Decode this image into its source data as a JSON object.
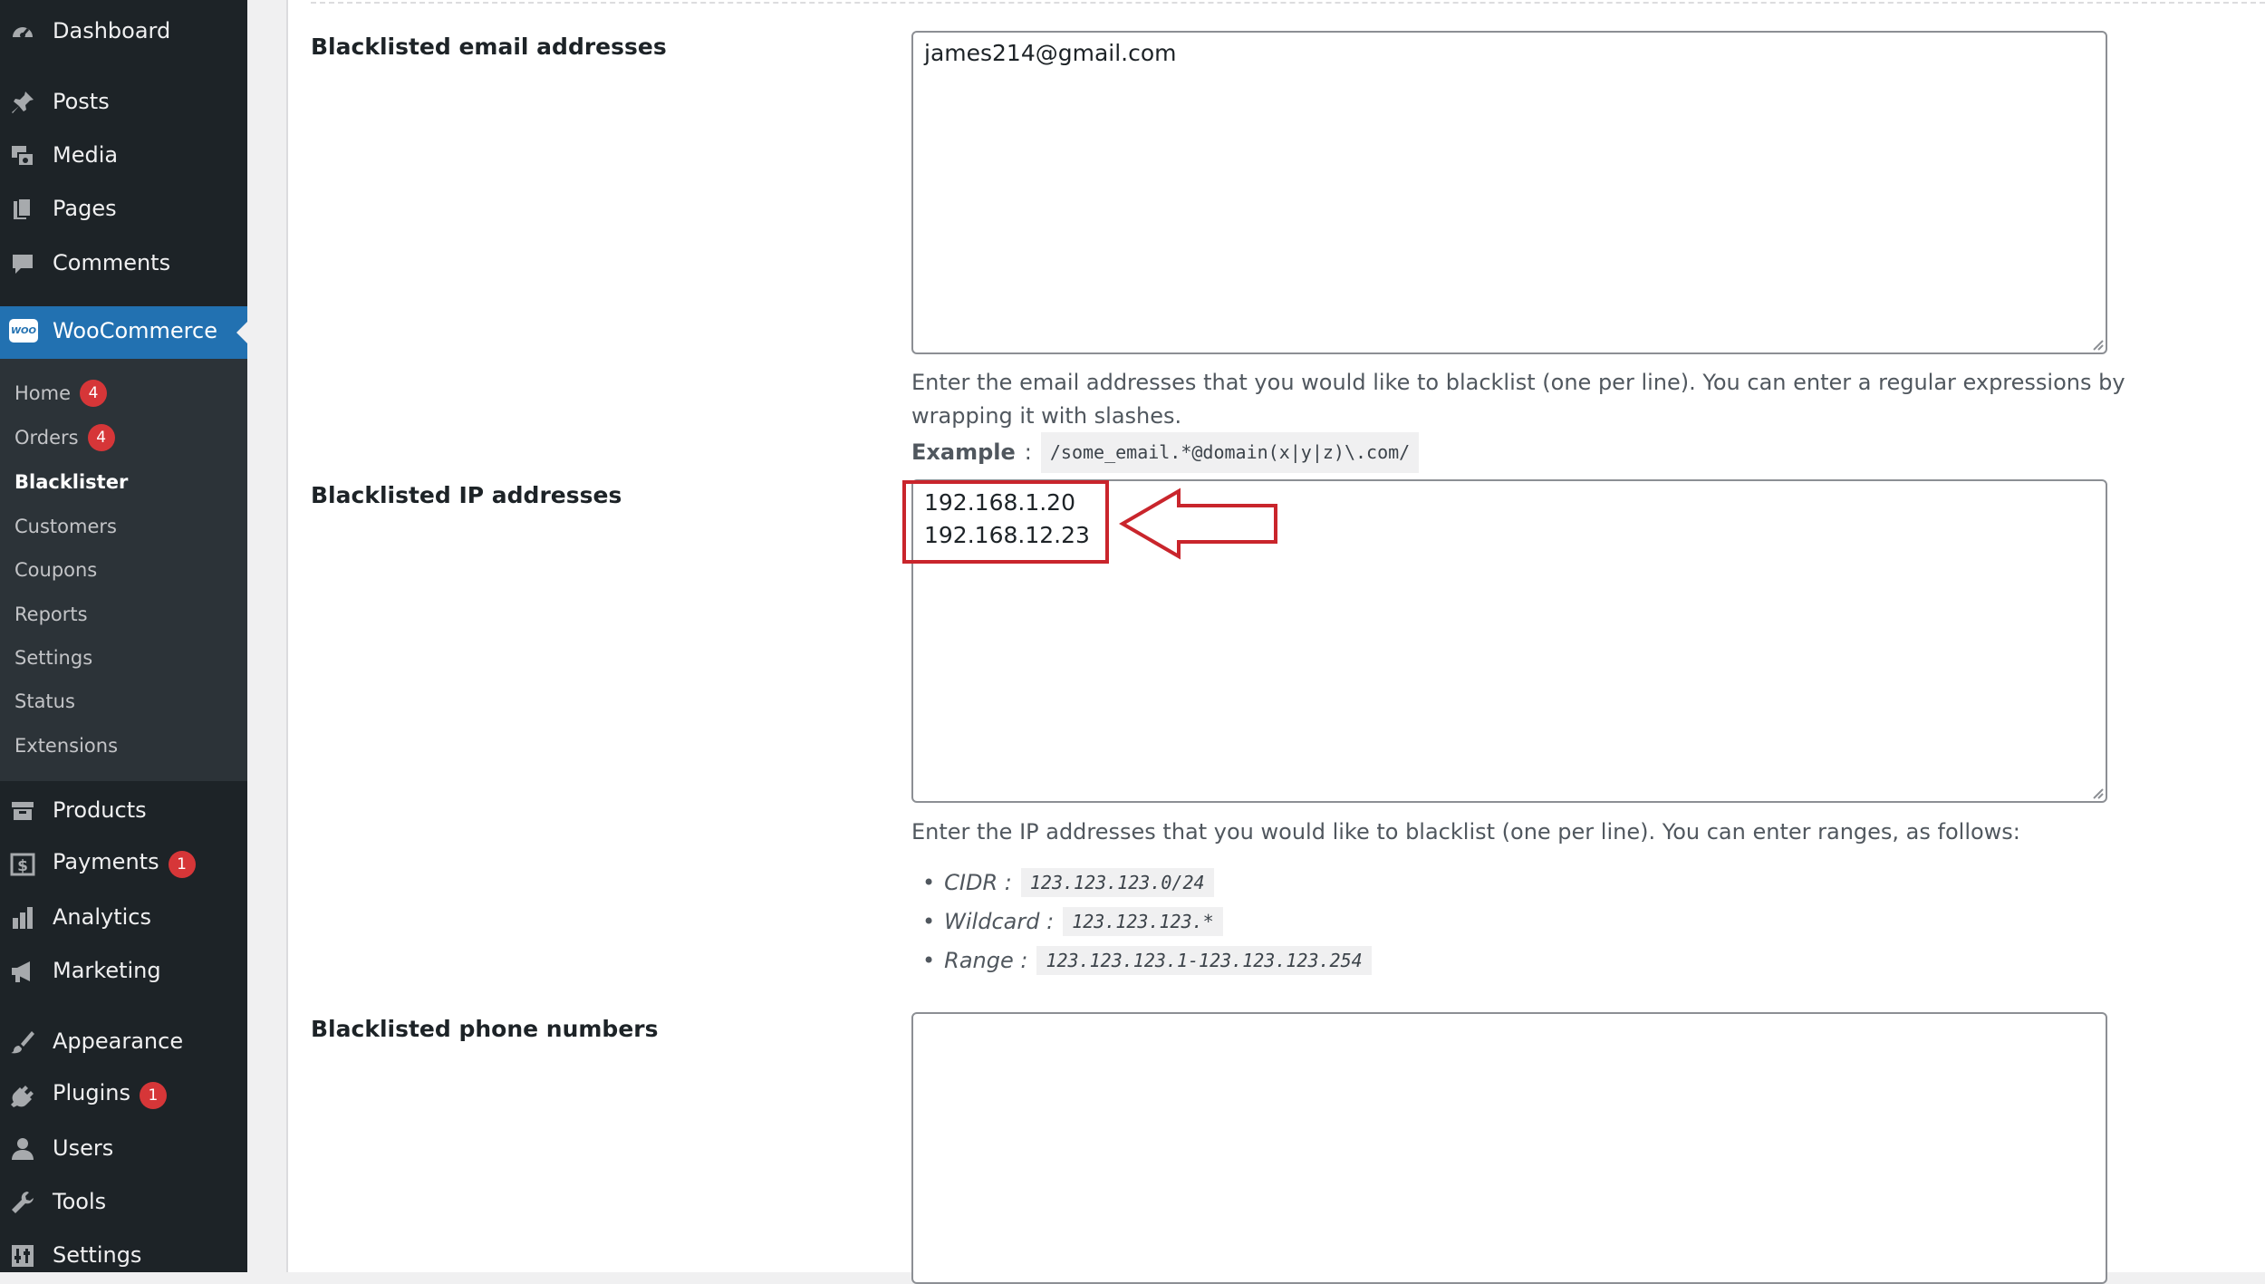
{
  "sidebar": {
    "top_items": [
      {
        "label": "Dashboard",
        "icon": "dashboard-icon"
      },
      {
        "label": "Posts",
        "icon": "pin-icon"
      },
      {
        "label": "Media",
        "icon": "media-icon"
      },
      {
        "label": "Pages",
        "icon": "pages-icon"
      },
      {
        "label": "Comments",
        "icon": "comment-icon"
      }
    ],
    "woocommerce": {
      "label": "WooCommerce",
      "icon": "woo-icon",
      "icon_text": "WOO"
    },
    "submenu": [
      {
        "label": "Home",
        "badge": "4"
      },
      {
        "label": "Orders",
        "badge": "4"
      },
      {
        "label": "Blacklister",
        "current": true
      },
      {
        "label": "Customers"
      },
      {
        "label": "Coupons"
      },
      {
        "label": "Reports"
      },
      {
        "label": "Settings"
      },
      {
        "label": "Status"
      },
      {
        "label": "Extensions"
      }
    ],
    "bottom_items": [
      {
        "label": "Products",
        "icon": "archive-icon"
      },
      {
        "label": "Payments",
        "icon": "dollar-icon",
        "badge": "1"
      },
      {
        "label": "Analytics",
        "icon": "bar-chart-icon"
      },
      {
        "label": "Marketing",
        "icon": "megaphone-icon"
      },
      {
        "label": "Appearance",
        "icon": "brush-icon"
      },
      {
        "label": "Plugins",
        "icon": "plug-icon",
        "badge": "1"
      },
      {
        "label": "Users",
        "icon": "user-icon"
      },
      {
        "label": "Tools",
        "icon": "wrench-icon"
      },
      {
        "label": "Settings",
        "icon": "settings-icon"
      }
    ]
  },
  "main": {
    "email_section": {
      "label": "Blacklisted email addresses",
      "value": "james214@gmail.com",
      "description": "Enter the email addresses that you would like to blacklist (one per line). You can enter a regular expressions by wrapping it with slashes.",
      "example_label": "Example",
      "example_sep": ":",
      "example_code": "/some_email.*@domain(x|y|z)\\.com/"
    },
    "ip_section": {
      "label": "Blacklisted IP addresses",
      "value": "192.168.1.20\n192.168.12.23",
      "description": "Enter the IP addresses that you would like to blacklist (one per line). You can enter ranges, as follows:",
      "ranges": [
        {
          "label": "CIDR :",
          "code": "123.123.123.0/24"
        },
        {
          "label": "Wildcard :",
          "code": "123.123.123.*"
        },
        {
          "label": "Range :",
          "code": "123.123.123.1-123.123.123.254"
        }
      ]
    },
    "phone_section": {
      "label": "Blacklisted phone numbers",
      "value": ""
    }
  },
  "colors": {
    "sidebar": "#1d2327",
    "submenu": "#2c3338",
    "accent": "#2271b1",
    "badge": "#d63638",
    "highlight": "#c9252c"
  }
}
